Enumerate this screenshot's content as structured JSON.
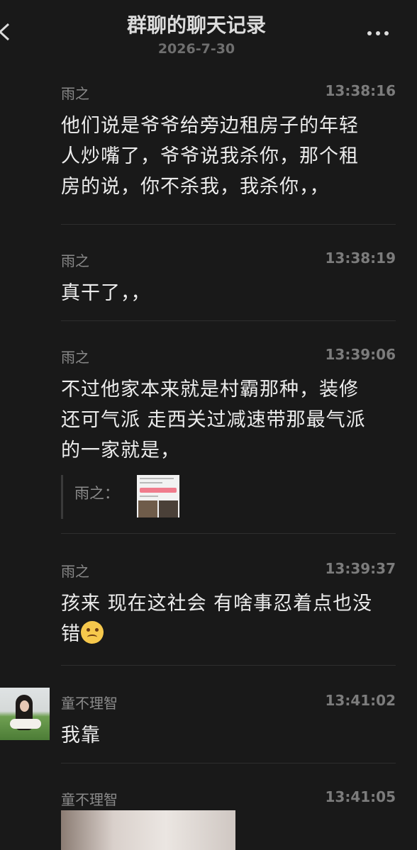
{
  "header": {
    "title": "群聊的聊天记录",
    "date": "2026-7-30"
  },
  "icons": {
    "back": "chevron-left-icon",
    "more": "more-dots-icon"
  },
  "messages": [
    {
      "sender": "雨之",
      "time": "13:38:16",
      "lines": [
        "他们说是爷爷给旁边租房子的年轻",
        "人炒嘴了，爷爷说我杀你，那个租",
        "房的说，你不杀我，我杀你，，"
      ]
    },
    {
      "sender": "雨之",
      "time": "13:38:19",
      "lines": [
        "真干了，，"
      ]
    },
    {
      "sender": "雨之",
      "time": "13:39:06",
      "lines": [
        "不过他家本来就是村霸那种，装修",
        "还可气派 走西关过减速带那最气派",
        "的一家就是，"
      ],
      "quote_label": "雨之："
    },
    {
      "sender": "雨之",
      "time": "13:39:37",
      "lines": [
        "孩来 现在这社会 有啥事忍着点也没",
        "错"
      ],
      "emoji": "grimacing-emoji"
    },
    {
      "sender": "童不理智",
      "time": "13:41:02",
      "lines": [
        "我靠"
      ]
    },
    {
      "sender": "童不理智",
      "time": "13:41:05"
    }
  ]
}
